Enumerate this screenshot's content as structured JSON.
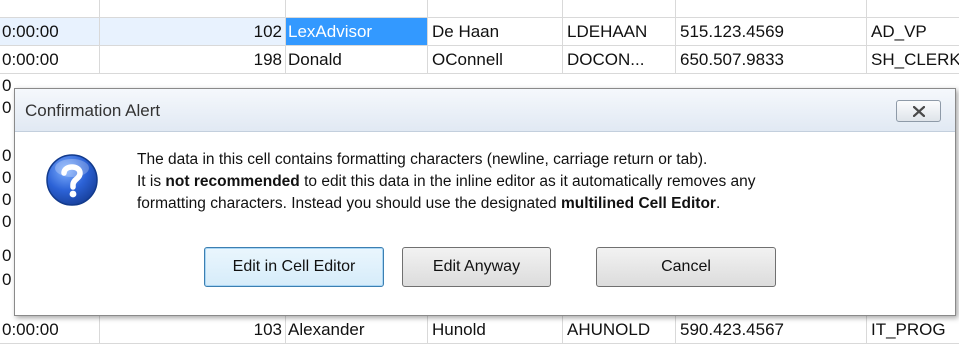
{
  "grid": {
    "rows": [
      {
        "time": "0:00:00",
        "id": "102",
        "first": "LexAdvisor",
        "last": "De Haan",
        "user": "LDEHAAN",
        "phone": "515.123.4569",
        "job": "AD_VP"
      },
      {
        "time": "0:00:00",
        "id": "198",
        "first": "Donald",
        "last": "OConnell",
        "user": "DOCON...",
        "phone": "650.507.9833",
        "job": "SH_CLERK"
      },
      {
        "time": "0:00:00",
        "id": "103",
        "first": "Alexander",
        "last": "Hunold",
        "user": "AHUNOLD",
        "phone": "590.423.4567",
        "job": "IT_PROG"
      }
    ],
    "left_fragments": [
      "0",
      "0",
      "0",
      "0",
      "0",
      "0",
      "0",
      "0"
    ]
  },
  "dialog": {
    "title": "Confirmation Alert",
    "icon": "question-icon",
    "line1": "The data in this cell contains formatting characters (newline, carriage return or tab).",
    "line2_a": "It is ",
    "line2_b": "not recommended",
    "line2_c": " to edit this data in the inline editor as it automatically removes any",
    "line3_a": "formatting characters. Instead you should use the designated ",
    "line3_b": "multilined Cell Editor",
    "line3_c": ".",
    "buttons": {
      "edit_cell_editor": "Edit in Cell Editor",
      "edit_anyway": "Edit Anyway",
      "cancel": "Cancel"
    }
  }
}
